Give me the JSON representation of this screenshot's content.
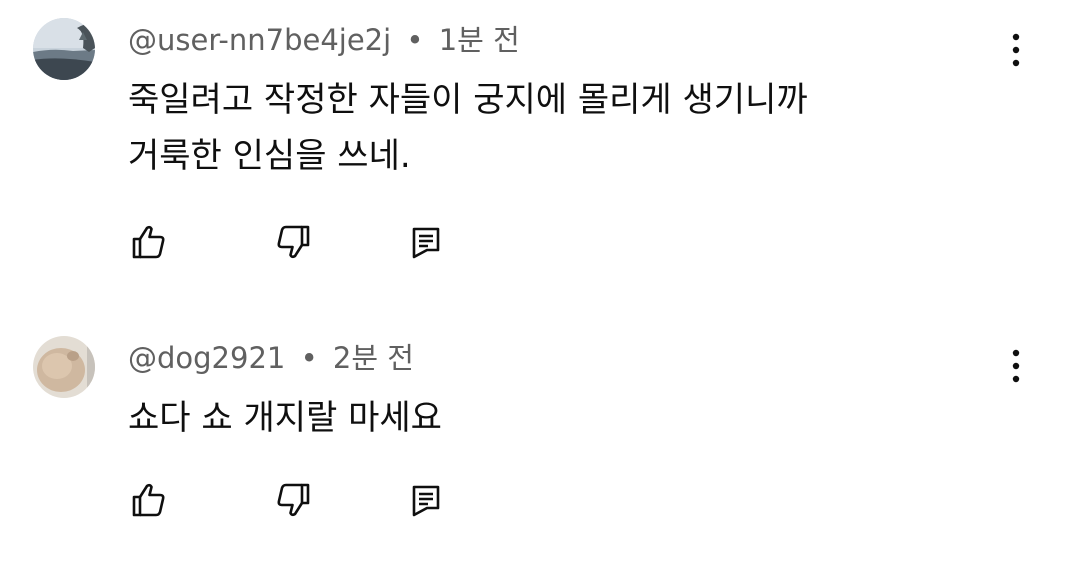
{
  "comments": [
    {
      "handle": "@user-nn7be4je2j",
      "separator": "•",
      "time": "1분 전",
      "lines": [
        "죽일려고 작정한 자들이 궁지에 몰리게 생기니까",
        "거룩한 인심을 쓰네."
      ],
      "avatar_icon": "landscape-avatar"
    },
    {
      "handle": "@dog2921",
      "separator": "•",
      "time": "2분 전",
      "lines": [
        "쇼다 쇼 개지랄 마세요"
      ],
      "avatar_icon": "beige-avatar"
    }
  ],
  "icons": {
    "like": "thumbs-up-icon",
    "dislike": "thumbs-down-icon",
    "reply": "reply-icon",
    "more": "more-vert-icon"
  },
  "colors": {
    "meta_text": "#606060",
    "body_text": "#0f0f0f",
    "background": "#ffffff"
  }
}
